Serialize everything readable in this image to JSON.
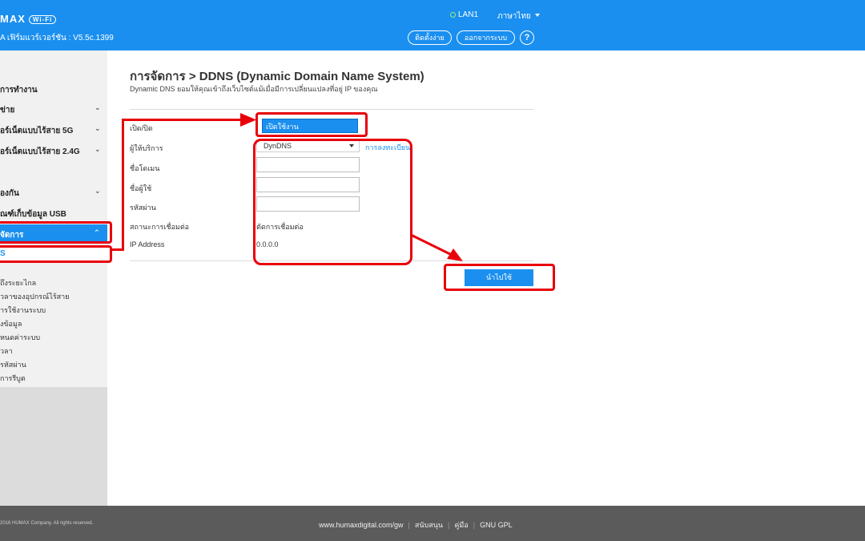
{
  "header": {
    "logo_text": "MAX",
    "logo_badge": "Wi-Fi",
    "firmware": "A เฟิร์มแวร์เวอร์ชัน : V5.5c.1399",
    "lan_status": "LAN1",
    "language": "ภาษาไทย",
    "setup_label": "ติดตั้งง่าย",
    "logout_label": "ออกจากระบบ",
    "help_label": "?"
  },
  "sidebar": {
    "items": [
      {
        "label": "การทำงาน"
      },
      {
        "label": "ข่าย"
      },
      {
        "label": "อร์เน็ตแบบไร้สาย 5G"
      },
      {
        "label": "อร์เน็ตแบบไร้สาย 2.4G"
      },
      {
        "label": "องกัน"
      },
      {
        "label": "ณฑ์เก็บข้อมูล USB"
      }
    ],
    "active": "จัดการ",
    "selected": "S",
    "subitems": [
      "ถึงระยะไกล",
      "วลาของอุปกรณ์ไร้สาย",
      "ารใช้งานระบบ",
      "งข้อมูล",
      "หนดค่าระบบ",
      "วลา",
      "รหัสผ่าน",
      "การรีบูต"
    ]
  },
  "main": {
    "title": "การจัดการ > DDNS (Dynamic Domain Name System)",
    "subtitle": "Dynamic DNS ยอมให้คุณเข้าถึงเว็บไซต์แม้เมื่อมีการเปลี่ยนแปลงที่อยู่ IP ของคุณ",
    "fields": {
      "enable_label": "เปิด/ปิด",
      "enable_value": "เปิดใช้งาน",
      "provider_label": "ผู้ให้บริการ",
      "provider_value": "DynDNS",
      "register_link": "การลงทะเบียน",
      "domain_label": "ชื่อโดเมน",
      "username_label": "ชื่อผู้ใช้",
      "password_label": "รหัสผ่าน",
      "status_label": "สถานะการเชื่อมต่อ",
      "status_value": "ตัดการเชื่อมต่อ",
      "ip_label": "IP Address",
      "ip_value": "0.0.0.0"
    },
    "apply_label": "นำไปใช้"
  },
  "footer": {
    "copyright": "2016 HUMAX Company. All rights reserved.",
    "links": [
      "www.humaxdigital.com/gw",
      "สนับสนุน",
      "คู่มือ",
      "GNU GPL"
    ]
  },
  "colors": {
    "accent": "#1a8ff0",
    "annotation": "#e8000a",
    "footer": "#5b5b5b"
  }
}
